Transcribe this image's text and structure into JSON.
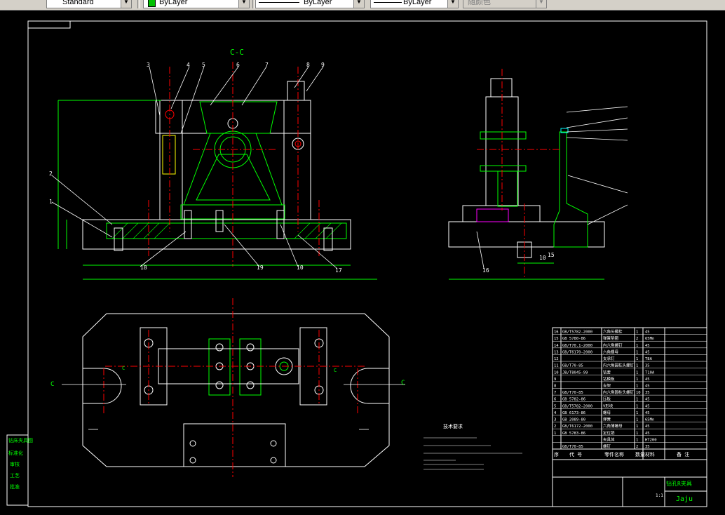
{
  "toolbar": {
    "text_style": "Standard",
    "layer_color": "ByLayer",
    "linetype": "ByLayer",
    "lineweight": "ByLayer",
    "plot_style": "随颜色",
    "colors": {
      "layer_swatch": "#00c000"
    }
  },
  "drawing": {
    "section_label": "C-C",
    "section_mark_left": "C",
    "section_mark_right": "C",
    "cut_mark_left": "C",
    "cut_mark_right": "C",
    "callouts_top": [
      "3",
      "4",
      "5",
      "6",
      "7",
      "8",
      "9"
    ],
    "callouts_left": [
      "2",
      "1"
    ],
    "callouts_bottom": [
      "18",
      "19",
      "10",
      "17"
    ],
    "side_view_callout": "16",
    "side_dims": [
      "10",
      "15"
    ],
    "tech_req_title": "技术要求",
    "colors": {
      "outline": "#ffffff",
      "green": "#00ff00",
      "red": "#ff0000",
      "yellow": "#ffff00",
      "magenta": "#ff00ff",
      "cyan": "#00ffff"
    }
  },
  "parts_list": {
    "rows": [
      {
        "no": "16",
        "code": "GB/T5782-2000",
        "name": "六角头螺栓",
        "qty": "1",
        "mat": "45"
      },
      {
        "no": "15",
        "code": "GB 5780-86",
        "name": "弹簧垫圈",
        "qty": "2",
        "mat": "65Mn"
      },
      {
        "no": "14",
        "code": "GB/T70.1-2000",
        "name": "内六角螺钉",
        "qty": "1",
        "mat": "45"
      },
      {
        "no": "13",
        "code": "GB/T6170-2000",
        "name": "六角螺母",
        "qty": "1",
        "mat": "45"
      },
      {
        "no": "12",
        "code": "",
        "name": "支承钉",
        "qty": "1",
        "mat": "T8A"
      },
      {
        "no": "11",
        "code": "GB/T70-85",
        "name": "内六角圆柱头螺钉",
        "qty": "1",
        "mat": "35"
      },
      {
        "no": "10",
        "code": "JB/T8045-99",
        "name": "钻套",
        "qty": "1",
        "mat": "T10A"
      },
      {
        "no": "9",
        "code": "",
        "name": "钻模板",
        "qty": "1",
        "mat": "45"
      },
      {
        "no": "8",
        "code": "",
        "name": "支架",
        "qty": "1",
        "mat": "45"
      },
      {
        "no": "7",
        "code": "GB/T70-85",
        "name": "内六角圆柱头螺钉",
        "qty": "10",
        "mat": "35"
      },
      {
        "no": "6",
        "code": "GB 5782-86",
        "name": "压板",
        "qty": "1",
        "mat": "45"
      },
      {
        "no": "5",
        "code": "GB/T5782-2000",
        "name": "V形块",
        "qty": "1",
        "mat": "45"
      },
      {
        "no": "4",
        "code": "GB 6173-86",
        "name": "螺母",
        "qty": "1",
        "mat": "45"
      },
      {
        "no": "3",
        "code": "GB 2089-80",
        "name": "弹簧",
        "qty": "1",
        "mat": "65Mn"
      },
      {
        "no": "2",
        "code": "GB/T6172-2000",
        "name": "六角薄螺母",
        "qty": "1",
        "mat": "45"
      },
      {
        "no": "1",
        "code": "GB 5783-86",
        "name": "定位销",
        "qty": "1",
        "mat": "45"
      },
      {
        "no": "",
        "code": "",
        "name": "夹具体",
        "qty": "1",
        "mat": "HT200"
      },
      {
        "no": "",
        "code": "GB/T70-85",
        "name": "螺钉",
        "qty": "2",
        "mat": "35"
      }
    ],
    "header": {
      "no": "序",
      "code": "代  号",
      "name": "零件名称",
      "qty": "数量",
      "mat": "材料",
      "note": "备  注"
    }
  },
  "title_block": {
    "title": "钻孔R夹具",
    "drawing_no": "Jaju",
    "scale": "1:1"
  },
  "left_strip": [
    "钻床夹具图",
    "标准化",
    "审核",
    "工艺",
    "批准"
  ]
}
